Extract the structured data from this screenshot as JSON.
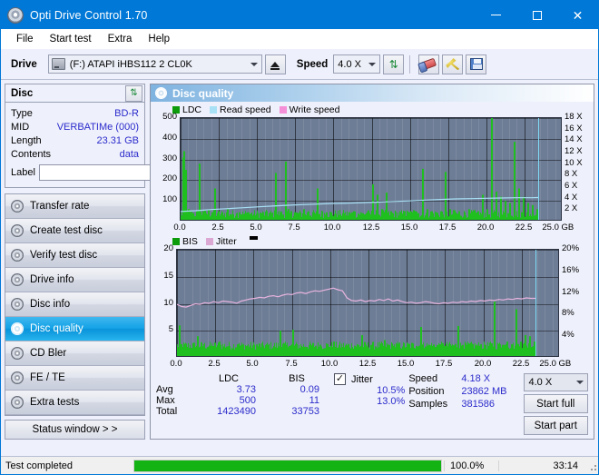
{
  "window": {
    "title": "Opti Drive Control 1.70",
    "icon": "disc-icon",
    "minimize": "–",
    "maximize": "□",
    "close": "✕"
  },
  "menu": {
    "items": [
      "File",
      "Start test",
      "Extra",
      "Help"
    ]
  },
  "toolbar": {
    "drive_label": "Drive",
    "drive_value": "(F:)  ATAPI iHBS112  2 CL0K",
    "eject_icon": "eject-icon",
    "speed_label": "Speed",
    "speed_value": "4.0 X",
    "refresh_icon": "refresh-icon",
    "eraser_icon": "eraser-icon",
    "tools_icon": "tools-icon",
    "save_icon": "save-icon"
  },
  "sidebar": {
    "disc_panel": {
      "title": "Disc",
      "refresh_icon": "refresh-icon",
      "rows": [
        {
          "key": "Type",
          "value": "BD-R"
        },
        {
          "key": "MID",
          "value": "VERBATIMe (000)"
        },
        {
          "key": "Length",
          "value": "23.31 GB"
        },
        {
          "key": "Contents",
          "value": "data"
        }
      ],
      "label_key": "Label",
      "label_value": "",
      "label_placeholder": "",
      "disc_button_icon": "disc-icon"
    },
    "nav": [
      {
        "label": "Transfer rate",
        "active": false
      },
      {
        "label": "Create test disc",
        "active": false
      },
      {
        "label": "Verify test disc",
        "active": false
      },
      {
        "label": "Drive info",
        "active": false
      },
      {
        "label": "Disc info",
        "active": false
      },
      {
        "label": "Disc quality",
        "active": true
      },
      {
        "label": "CD Bler",
        "active": false
      },
      {
        "label": "FE / TE",
        "active": false
      },
      {
        "label": "Extra tests",
        "active": false
      }
    ],
    "status_window_button": "Status window > >"
  },
  "main": {
    "title": "Disc quality",
    "title_icon": "disc-icon"
  },
  "stats": {
    "col_headers": [
      "LDC",
      "BIS"
    ],
    "rows": [
      {
        "key": "Avg",
        "ldc": "3.73",
        "bis": "0.09",
        "jitter": "10.5%"
      },
      {
        "key": "Max",
        "ldc": "500",
        "bis": "11",
        "jitter": "13.0%"
      },
      {
        "key": "Total",
        "ldc": "1423490",
        "bis": "33753",
        "jitter": ""
      }
    ],
    "jitter_label": "Jitter",
    "jitter_checked": true,
    "checkmark": "✓",
    "speed_key": "Speed",
    "speed_value": "4.18 X",
    "position_key": "Position",
    "position_value": "23862 MB",
    "samples_key": "Samples",
    "samples_value": "381586",
    "speed_select": "4.0 X",
    "start_full": "Start full",
    "start_part": "Start part"
  },
  "statusbar": {
    "text": "Test completed",
    "percent": "100.0%",
    "progress": 100,
    "time": "33:14"
  },
  "colors": {
    "accent": "#0078d7",
    "plot_bg": "#6e7d96",
    "ldc_green": "#1fbf1f",
    "read_speed": "#a8e0f5",
    "write_speed": "#f58fd8",
    "jitter_pink": "#e8b4de",
    "progress_green": "#12b312",
    "value_blue": "#2c2ccc"
  },
  "chart_data": [
    {
      "id": "ldc-chart",
      "type": "line",
      "title": "",
      "xlabel": "GB",
      "ylabel": "",
      "xlim": [
        0,
        25
      ],
      "xticks": [
        "0.0",
        "2.5",
        "5.0",
        "7.5",
        "10.0",
        "12.5",
        "15.0",
        "17.5",
        "20.0",
        "22.5",
        "25.0 GB"
      ],
      "ylim": [
        0,
        500
      ],
      "yticks": [
        "100",
        "200",
        "300",
        "400",
        "500"
      ],
      "y2lim": [
        0,
        18
      ],
      "y2ticks": [
        "2 X",
        "4 X",
        "6 X",
        "8 X",
        "10 X",
        "12 X",
        "14 X",
        "16 X",
        "18 X"
      ],
      "grid": true,
      "legend_position": "top-left",
      "legend": [
        {
          "name": "LDC",
          "color": "#1fbf1f"
        },
        {
          "name": "Read speed",
          "color": "#a8e0f5"
        },
        {
          "name": "Write speed",
          "color": "#f58fd8"
        }
      ],
      "series": [
        {
          "name": "LDC",
          "type": "bar",
          "color": "#1fbf1f",
          "x": [
            0.1,
            0.2,
            0.3,
            0.45,
            0.6,
            0.8,
            1.0,
            1.2,
            1.4,
            1.6,
            1.8,
            2.0,
            2.2,
            2.4,
            2.6,
            2.8,
            3.0,
            3.2,
            3.4,
            3.6,
            3.8,
            4.0,
            4.2,
            4.4,
            4.6,
            4.8,
            5.0,
            5.3,
            5.6,
            5.9,
            6.2,
            6.5,
            6.8,
            7.0,
            7.2,
            7.4,
            7.6,
            7.8,
            8.0,
            8.3,
            8.6,
            8.9,
            9.2,
            9.5,
            9.8,
            10.1,
            10.4,
            10.7,
            11.0,
            11.3,
            11.6,
            11.9,
            12.2,
            12.5,
            12.8,
            13.1,
            13.4,
            13.7,
            14.0,
            14.3,
            14.6,
            14.9,
            15.2,
            15.5,
            15.8,
            16.1,
            16.4,
            16.7,
            17.0,
            17.3,
            17.6,
            17.9,
            18.2,
            18.5,
            18.8,
            19.1,
            19.4,
            19.7,
            20.0,
            20.3,
            20.6,
            20.9,
            21.2,
            21.5,
            21.8,
            22.1,
            22.4,
            22.7,
            23.0,
            23.3
          ],
          "values": [
            310,
            340,
            250,
            60,
            45,
            40,
            35,
            280,
            50,
            40,
            55,
            45,
            160,
            40,
            35,
            30,
            60,
            35,
            30,
            40,
            45,
            35,
            30,
            45,
            40,
            30,
            35,
            40,
            50,
            40,
            235,
            45,
            290,
            60,
            50,
            45,
            40,
            35,
            60,
            50,
            45,
            160,
            50,
            45,
            40,
            38,
            35,
            40,
            45,
            50,
            38,
            40,
            45,
            180,
            130,
            60,
            140,
            50,
            45,
            40,
            50,
            45,
            55,
            40,
            255,
            60,
            50,
            45,
            50,
            240,
            60,
            55,
            50,
            45,
            60,
            55,
            50,
            130,
            60,
            500,
            145,
            120,
            100,
            90,
            385,
            160,
            120,
            90,
            80,
            60
          ]
        },
        {
          "name": "Read speed",
          "type": "line",
          "color": "#a8e0f5",
          "axis": "right",
          "x": [
            0.0,
            1.0,
            2.0,
            3.0,
            4.0,
            5.0,
            6.0,
            7.0,
            8.0,
            9.0,
            10.0,
            11.0,
            12.0,
            13.0,
            14.0,
            15.0,
            16.0,
            17.0,
            18.0,
            19.0,
            20.0,
            21.0,
            22.0,
            23.0,
            23.4
          ],
          "values": [
            1.75,
            1.9,
            2.1,
            2.25,
            2.4,
            2.55,
            2.7,
            2.85,
            2.95,
            3.05,
            3.15,
            3.2,
            3.3,
            3.4,
            3.5,
            3.6,
            3.75,
            3.85,
            3.95,
            4.0,
            4.05,
            4.1,
            4.15,
            4.15,
            4.18
          ]
        },
        {
          "name": "Write speed",
          "type": "line",
          "color": "#f58fd8",
          "axis": "right",
          "x": [],
          "values": []
        }
      ]
    },
    {
      "id": "bis-chart",
      "type": "line",
      "title": "",
      "xlabel": "GB",
      "ylabel": "",
      "xlim": [
        0,
        25
      ],
      "xticks": [
        "0.0",
        "2.5",
        "5.0",
        "7.5",
        "10.0",
        "12.5",
        "15.0",
        "17.5",
        "20.0",
        "22.5",
        "25.0 GB"
      ],
      "ylim": [
        0,
        20
      ],
      "yticks": [
        "5",
        "10",
        "15",
        "20"
      ],
      "y2lim": [
        0,
        20
      ],
      "y2ticks": [
        "4%",
        "8%",
        "12%",
        "16%",
        "20%"
      ],
      "grid": true,
      "legend_position": "top-left",
      "legend": [
        {
          "name": "BIS",
          "color": "#1fbf1f"
        },
        {
          "name": "Jitter",
          "color": "#e8b4de"
        }
      ],
      "series": [
        {
          "name": "BIS",
          "type": "bar",
          "color": "#1fbf1f",
          "x": [
            0.1,
            0.3,
            0.5,
            0.7,
            0.9,
            1.1,
            1.3,
            1.5,
            1.7,
            1.9,
            2.1,
            2.3,
            2.5,
            2.7,
            2.9,
            3.1,
            3.3,
            3.5,
            3.7,
            3.9,
            4.1,
            4.3,
            4.5,
            4.7,
            4.9,
            5.1,
            5.3,
            5.5,
            5.7,
            5.9,
            6.1,
            6.3,
            6.5,
            6.7,
            6.9,
            7.1,
            7.3,
            7.5,
            7.7,
            7.9,
            8.1,
            8.4,
            8.7,
            9.0,
            9.3,
            9.6,
            9.9,
            10.2,
            10.5,
            10.8,
            11.1,
            11.4,
            11.7,
            12.0,
            12.3,
            12.6,
            12.9,
            13.2,
            13.5,
            13.8,
            14.1,
            14.4,
            14.7,
            15.0,
            15.3,
            15.6,
            15.9,
            16.2,
            16.5,
            16.8,
            17.1,
            17.4,
            17.7,
            18.0,
            18.3,
            18.6,
            18.9,
            19.2,
            19.5,
            19.8,
            20.1,
            20.4,
            20.7,
            20.9,
            21.2,
            21.5,
            21.8,
            22.1,
            22.4,
            22.7,
            23.0,
            23.3
          ],
          "values": [
            6.0,
            2.0,
            1.5,
            1.8,
            1.5,
            2.0,
            4.0,
            1.5,
            2.5,
            1.3,
            1.5,
            2.2,
            1.4,
            3.0,
            1.5,
            1.3,
            2.0,
            1.5,
            1.4,
            2.5,
            1.3,
            1.5,
            2.0,
            1.4,
            1.8,
            1.5,
            1.3,
            1.5,
            1.4,
            1.6,
            1.5,
            1.4,
            1.8,
            5.0,
            1.6,
            1.5,
            2.2,
            5.2,
            1.6,
            1.5,
            1.8,
            2.0,
            1.7,
            1.6,
            2.4,
            1.8,
            2.0,
            3.0,
            1.9,
            2.0,
            2.2,
            2.0,
            1.9,
            4.2,
            2.0,
            2.4,
            2.1,
            2.2,
            3.3,
            2.0,
            2.2,
            2.6,
            2.1,
            2.3,
            2.0,
            2.2,
            5.7,
            2.1,
            2.3,
            2.0,
            2.5,
            2.2,
            2.6,
            2.3,
            5.9,
            2.4,
            2.2,
            2.6,
            2.3,
            2.5,
            2.4,
            2.8,
            10.4,
            2.6,
            2.4,
            3.0,
            2.5,
            9.0,
            3.0,
            4.2,
            4.0,
            3.0
          ]
        },
        {
          "name": "Jitter",
          "type": "line",
          "color": "#e8b4de",
          "axis": "right",
          "x": [
            0.0,
            0.3,
            0.6,
            0.9,
            1.2,
            1.5,
            1.8,
            2.1,
            2.4,
            2.7,
            3.0,
            3.3,
            3.6,
            3.9,
            4.2,
            4.5,
            4.8,
            5.1,
            5.4,
            5.7,
            6.0,
            6.3,
            6.6,
            6.9,
            7.2,
            7.5,
            7.8,
            8.1,
            8.4,
            8.7,
            9.0,
            9.3,
            9.6,
            9.9,
            10.2,
            10.5,
            10.8,
            11.1,
            11.4,
            11.7,
            12.0,
            12.3,
            12.6,
            12.9,
            13.2,
            13.5,
            13.8,
            14.1,
            14.4,
            14.7,
            15.0,
            15.3,
            15.6,
            15.9,
            16.2,
            16.5,
            16.8,
            17.1,
            17.4,
            17.7,
            18.0,
            18.3,
            18.6,
            18.9,
            19.2,
            19.5,
            19.8,
            20.1,
            20.4,
            20.7,
            21.0,
            21.3,
            21.6,
            21.9,
            22.2,
            22.5,
            22.8,
            23.1,
            23.4
          ],
          "values": [
            9.9,
            9.5,
            9.4,
            9.7,
            10.0,
            9.9,
            10.2,
            10.1,
            10.4,
            10.2,
            10.5,
            10.4,
            10.3,
            10.1,
            10.5,
            10.7,
            10.9,
            11.0,
            11.2,
            11.1,
            11.4,
            11.5,
            11.3,
            11.6,
            11.8,
            11.7,
            12.0,
            12.1,
            11.9,
            12.2,
            12.4,
            12.3,
            12.5,
            12.7,
            12.9,
            12.6,
            12.4,
            11.1,
            10.6,
            10.5,
            10.7,
            10.4,
            10.6,
            10.5,
            10.8,
            10.6,
            10.9,
            10.5,
            10.7,
            10.4,
            10.2,
            10.3,
            10.1,
            10.2,
            10.4,
            10.3,
            10.1,
            10.0,
            10.2,
            10.1,
            10.3,
            10.2,
            10.4,
            10.3,
            10.5,
            10.4,
            10.6,
            10.5,
            10.7,
            10.6,
            10.8,
            10.7,
            10.9,
            10.8,
            11.0,
            10.9,
            11.1,
            11.0,
            11.0
          ]
        }
      ]
    }
  ]
}
